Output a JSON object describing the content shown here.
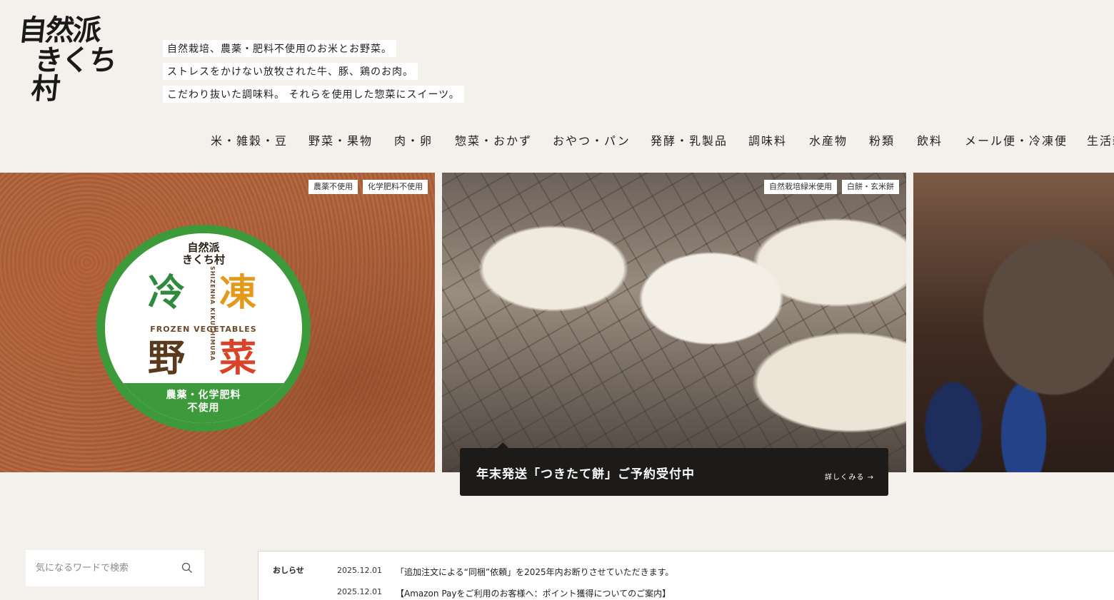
{
  "brand": {
    "logo_line1": "自然派",
    "logo_line2": "きくち村"
  },
  "tagline": [
    "自然栽培、農薬・肥料不使用のお米とお野菜。",
    "ストレスをかけない放牧された牛、豚、鶏のお肉。",
    "こだわり抜いた調味料。 それらを使用した惣菜にスイーツ。"
  ],
  "nav": [
    "米・雑穀・豆",
    "野菜・果物",
    "肉・卵",
    "惣菜・おかず",
    "おやつ・パン",
    "発酵・乳製品",
    "調味料",
    "水産物",
    "粉類",
    "飲料",
    "メール便・冷凍便",
    "生活雑"
  ],
  "slides": [
    {
      "tags": [
        "農薬不使用",
        "化学肥料不使用"
      ],
      "badge": {
        "logo_line1": "自然派",
        "logo_line2": "きくち村",
        "chars": [
          "冷",
          "凍",
          "野",
          "菜"
        ],
        "english": "FROZEN VEGETABLES",
        "vertical": "SHIZENHA KIKUCHIMURA",
        "foot_line1": "農薬・化学肥料",
        "foot_line2": "不使用"
      }
    },
    {
      "tags": [
        "自然栽培緑米使用",
        "白餅・玄米餅"
      ],
      "caption": "年末発送「つきたて餅」ご予約受付中",
      "more": "詳しくみる →"
    },
    {
      "tags": []
    }
  ],
  "search": {
    "placeholder": "気になるワードで検索"
  },
  "news": {
    "label": "おしらせ",
    "items": [
      {
        "date": "2025.12.01",
        "text": "「追加注文による“同梱”依頼」を2025年内お断りさせていただきます。"
      },
      {
        "date": "2025.12.01",
        "text": "【Amazon Payをご利用のお客様へ：ポイント獲得についてのご案内】"
      }
    ]
  },
  "colors": {
    "background": "#f4f1ec",
    "badge_green": "#3c9a3a",
    "char_green": "#2e8b3e",
    "char_orange": "#e39a1c",
    "char_brown": "#5a3a1c",
    "char_red": "#d8432a",
    "caption_bg": "#1c1b1a"
  }
}
